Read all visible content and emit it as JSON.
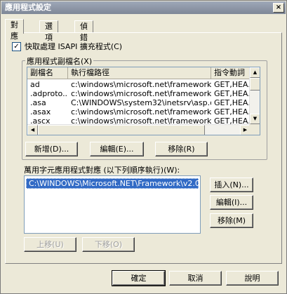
{
  "dialog": {
    "title": "應用程式設定",
    "close_glyph": "×"
  },
  "tabs": [
    {
      "label": "對應"
    },
    {
      "label": "選項"
    },
    {
      "label": "偵錯"
    }
  ],
  "cache_isapi": {
    "label": "快取處理 ISAPI 擴充程式(C)",
    "checked_glyph": "✓"
  },
  "extensions": {
    "group_label": "應用程式副檔名(X)",
    "columns": [
      "副檔名",
      "執行檔路徑",
      "指令動詞"
    ],
    "rows": [
      [
        "ad",
        "c:\\windows\\microsoft.net\\framework\\v...",
        "GET,HEA..."
      ],
      [
        ".adproto...",
        "c:\\windows\\microsoft.net\\framework\\v...",
        "GET,HEA..."
      ],
      [
        ".asa",
        "C:\\WINDOWS\\system32\\inetsrv\\asp.dll",
        "GET,HEA..."
      ],
      [
        ".asax",
        "c:\\windows\\microsoft.net\\framework\\v...",
        "GET,HEA..."
      ],
      [
        ".ascx",
        "c:\\windows\\microsoft.net\\framework\\v...",
        "GET,HEA..."
      ]
    ],
    "add_label": "新增(D)...",
    "edit_label": "編輯(E)...",
    "remove_label": "移除(R)"
  },
  "wildcard": {
    "label": "萬用字元應用程式對應 (以下列順序執行)(W):",
    "items": [
      "C:\\WINDOWS\\Microsoft.NET\\Framework\\v2.0.5..."
    ],
    "insert_label": "插入(N)...",
    "edit_label": "編輯(I)...",
    "remove_label": "移除(M)",
    "move_up_label": "上移(U)",
    "move_down_label": "下移(O)"
  },
  "footer": {
    "ok_label": "確定",
    "cancel_label": "取消",
    "help_label": "說明"
  },
  "icons": {
    "arrow_up": "▲",
    "arrow_down": "▼",
    "arrow_left": "◀",
    "arrow_right": "▶"
  }
}
